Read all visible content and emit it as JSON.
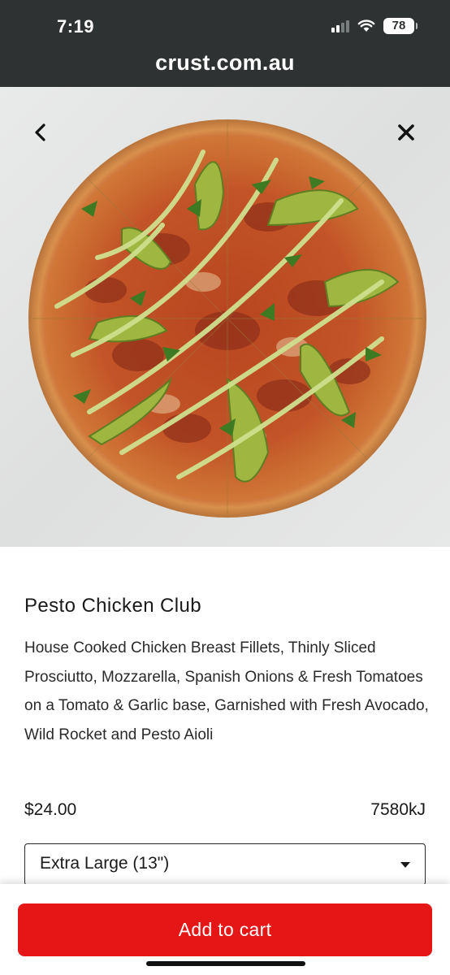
{
  "status_bar": {
    "time": "7:19",
    "battery": "78"
  },
  "browser": {
    "url": "crust.com.au"
  },
  "product": {
    "image_icon": "pizza-image",
    "name": "Pesto Chicken Club",
    "description": "House Cooked Chicken Breast Fillets, Thinly Sliced Prosciutto, Mozzarella, Spanish Onions & Fresh Tomatoes on a Tomato & Garlic base, Garnished with Fresh Avocado, Wild Rocket and Pesto Aioli",
    "price": "$24.00",
    "energy": "7580kJ"
  },
  "size_select": {
    "selected": "Extra Large (13\")"
  },
  "actions": {
    "add_to_cart": "Add to cart"
  },
  "colors": {
    "accent": "#e51616",
    "browser_bar": "#2f3232"
  }
}
